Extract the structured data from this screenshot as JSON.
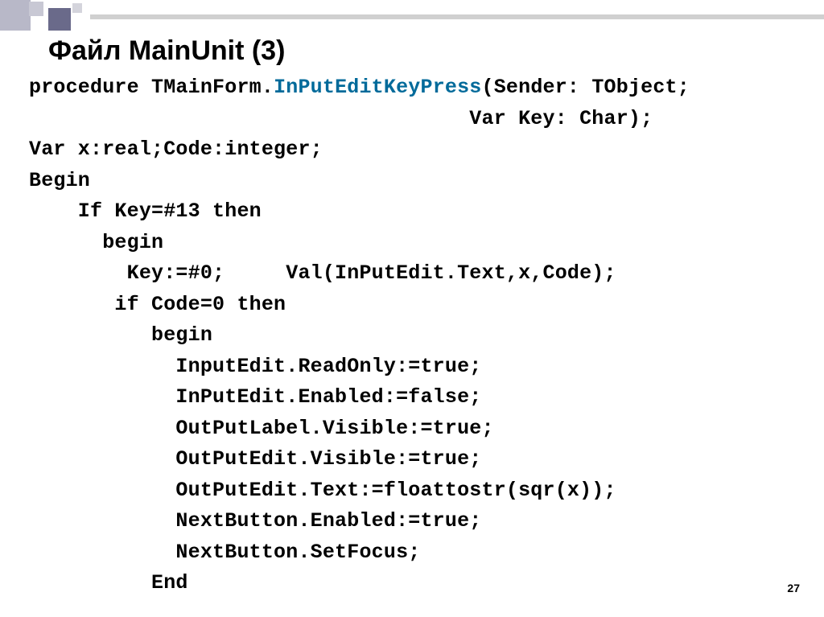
{
  "title": "Файл MainUnit (3)",
  "page_number": "27",
  "code": {
    "l1a": "procedure TMainForm.",
    "l1b": "InPutEditKeyPress",
    "l1c": "(Sender: TObject;",
    "l2": "                                    Var Key: Char);",
    "l3": "Var x:real;Code:integer;",
    "l4": "Begin",
    "l5": "    If Key=#13 then",
    "l6": "      begin",
    "l7": "        Key:=#0;     Val(InPutEdit.Text,x,Code);",
    "l8": "       if Code=0 then",
    "l9": "          begin",
    "l10": "            InputEdit.ReadOnly:=true;",
    "l11": "            InPutEdit.Enabled:=false;",
    "l12": "            OutPutLabel.Visible:=true;",
    "l13": "            OutPutEdit.Visible:=true;",
    "l14": "            OutPutEdit.Text:=floattostr(sqr(x));",
    "l15": "            NextButton.Enabled:=true;",
    "l16": "            NextButton.SetFocus;",
    "l17": "          End"
  }
}
